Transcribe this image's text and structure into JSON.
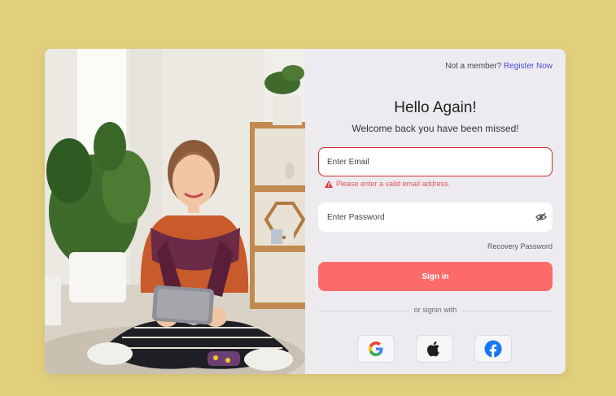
{
  "header": {
    "member_prompt": "Not a member?",
    "register_link": "Register Now"
  },
  "form": {
    "title": "Hello Again!",
    "subtitle": "Welcome back you have been missed!",
    "email_placeholder": "Enter Email",
    "email_value": "",
    "email_error": "Please enter a valid email address.",
    "password_placeholder": "Enter Password",
    "password_value": "",
    "recovery_link": "Recovery Password",
    "signin_label": "Sign in",
    "alt_signin": "or signin with"
  },
  "social": [
    {
      "provider": "google",
      "icon": "google-icon"
    },
    {
      "provider": "apple",
      "icon": "apple-icon"
    },
    {
      "provider": "facebook",
      "icon": "facebook-icon"
    }
  ],
  "colors": {
    "background": "#e2cf7e",
    "panel": "#eeebf0",
    "accent": "#fb6b68",
    "link": "#4a46e0",
    "error": "#e0555c",
    "error_border": "#cc2a2a"
  }
}
